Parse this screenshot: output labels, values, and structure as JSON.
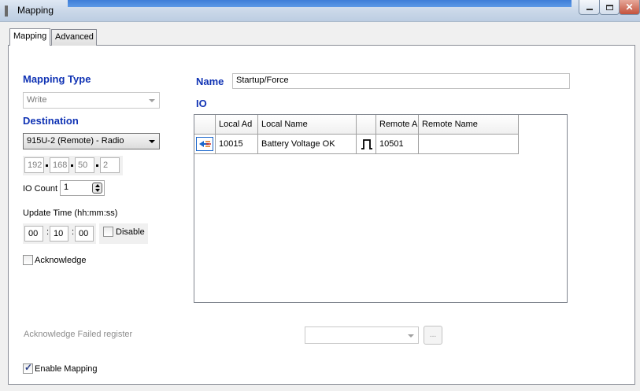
{
  "window": {
    "title": "Mapping",
    "controls": {
      "minimize": "minimize",
      "maximize": "maximize",
      "close": "✕"
    }
  },
  "tabs": [
    {
      "label": "Mapping",
      "active": true
    },
    {
      "label": "Advanced",
      "active": false
    }
  ],
  "form": {
    "mapping_type_label": "Mapping Type",
    "mapping_type_value": "Write",
    "destination_label": "Destination",
    "destination_value": "915U-2 (Remote) - Radio",
    "ip": [
      "192",
      "168",
      "50",
      "2"
    ],
    "io_count_label": "IO Count",
    "io_count_value": "1",
    "update_time_label": "Update Time  (hh:mm:ss)",
    "time": [
      "00",
      "10",
      "00"
    ],
    "time_sep": ":",
    "disable_label": "Disable",
    "disable_checked": false,
    "acknowledge_label": "Acknowledge",
    "acknowledge_checked": false
  },
  "name_label": "Name",
  "name_value": "Startup/Force",
  "io_label": "IO",
  "io_table": {
    "headers": [
      "",
      "Local Ad",
      "Local Name",
      "",
      "Remote A",
      "Remote Name"
    ],
    "rows": [
      {
        "icon": "mapping-arrow-icon",
        "local_address": "10015",
        "local_name": "Battery Voltage OK",
        "type_icon": "pulse-icon",
        "remote_address": "10501",
        "remote_name": ""
      }
    ]
  },
  "ack_failed_register_label": "Acknowledge Failed register",
  "ack_failed_register_value": "",
  "browse_button_label": "...",
  "enable_mapping_label": "Enable Mapping",
  "enable_mapping_checked": true,
  "colors": {
    "section_label": "#1033b4",
    "titlebar": "#c9d7e8",
    "close_button": "#c4523c"
  }
}
